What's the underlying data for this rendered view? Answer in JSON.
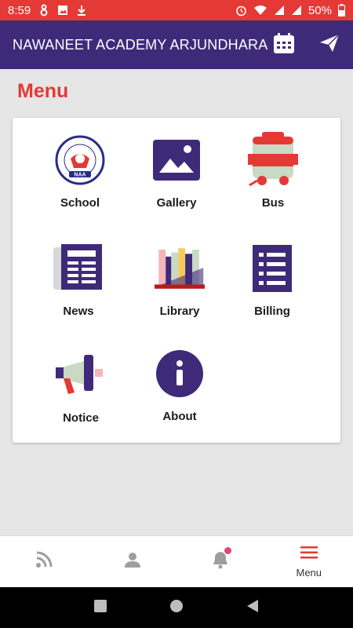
{
  "status_bar": {
    "time": "8:59",
    "battery": "50%",
    "icons": [
      "bug-icon",
      "image-icon",
      "download-icon",
      "alarm-icon",
      "wifi-icon",
      "signal-icon",
      "battery-icon"
    ]
  },
  "app_bar": {
    "title": "NAWANEET ACADEMY ARJUNDHARA",
    "actions": [
      "calendar-icon",
      "send-icon"
    ]
  },
  "page": {
    "title": "Menu"
  },
  "menu_items": [
    {
      "label": "School",
      "icon": "school-logo-icon"
    },
    {
      "label": "Gallery",
      "icon": "gallery-icon"
    },
    {
      "label": "Bus",
      "icon": "bus-icon"
    },
    {
      "label": "News",
      "icon": "news-icon"
    },
    {
      "label": "Library",
      "icon": "library-icon"
    },
    {
      "label": "Billing",
      "icon": "billing-icon"
    },
    {
      "label": "Notice",
      "icon": "megaphone-icon"
    },
    {
      "label": "About",
      "icon": "info-icon"
    }
  ],
  "logo_text": {
    "ring": "NAWANEET ACADEMY ARJUNDHARA",
    "banner": "NAA"
  },
  "bottom_nav": {
    "items": [
      {
        "icon": "feed-icon",
        "label": ""
      },
      {
        "icon": "person-icon",
        "label": ""
      },
      {
        "icon": "bell-icon",
        "label": ""
      },
      {
        "icon": "hamburger-menu-icon",
        "label": "Menu"
      }
    ]
  },
  "colors": {
    "status_bar": "#e53935",
    "app_bar": "#3f2a7a",
    "accent": "#e53935",
    "icon_purple": "#3f2a7a"
  }
}
